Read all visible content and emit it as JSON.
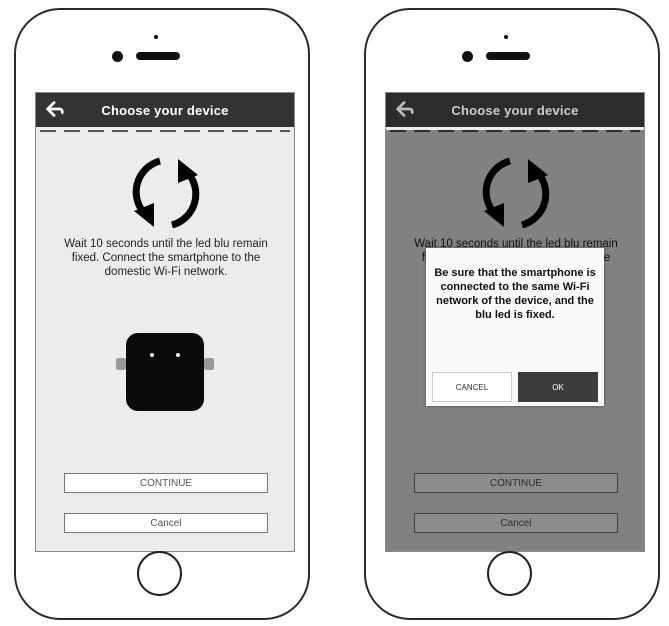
{
  "header": {
    "title": "Choose your device"
  },
  "instruction": "Wait 10 seconds until the led blu remain fixed. Connect the smartphone to the domestic Wi-Fi network.",
  "buttons": {
    "continue_label": "CONTINUE",
    "cancel_label": "Cancel"
  },
  "dialog": {
    "message": "Be sure that the smartphone is connected to the same Wi-Fi network of the device, and the blu led is fixed.",
    "cancel_label": "CANCEL",
    "ok_label": "OK"
  },
  "background_hint": {
    "line1": "Wait 10 seconds until the led blu",
    "line2": "remain fixed. Connect the",
    "line3": "* ... Wi-Fi"
  },
  "icons": [
    "back-arrow-icon",
    "refresh-icon",
    "device-image"
  ],
  "colors": {
    "header_bg": "#333333",
    "screen_bg": "#ececec",
    "overlay": "rgba(0,0,0,0.45)",
    "ok_bg": "#3c3c3c"
  }
}
